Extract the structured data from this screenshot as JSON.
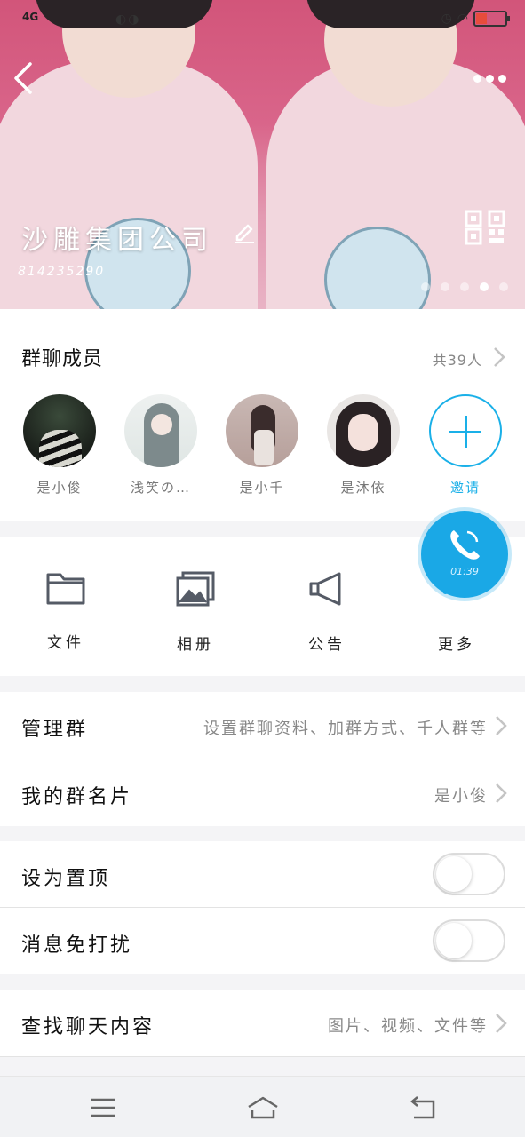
{
  "status_bar": {
    "signal": "4G",
    "time_partial": "09"
  },
  "header": {
    "group_name": "沙雕集团公司",
    "group_id": "814235290",
    "carousel_total": 5,
    "carousel_active": 4
  },
  "members": {
    "title": "群聊成员",
    "count_label": "共39人",
    "list": [
      {
        "name": "是小俊"
      },
      {
        "name": "浅笑の…"
      },
      {
        "name": "是小千"
      },
      {
        "name": "是沐依"
      }
    ],
    "invite_label": "邀请"
  },
  "tools": {
    "files": "文件",
    "album": "相册",
    "notice": "公告",
    "more": "更多"
  },
  "call": {
    "duration": "01:39"
  },
  "settings": {
    "manage": {
      "label": "管理群",
      "value": "设置群聊资料、加群方式、千人群等"
    },
    "my_card": {
      "label": "我的群名片",
      "value": "是小俊"
    },
    "pin_top": {
      "label": "设为置顶",
      "on": false
    },
    "mute": {
      "label": "消息免打扰",
      "on": false
    },
    "search_history": {
      "label": "查找聊天内容",
      "value": "图片、视频、文件等"
    }
  },
  "colors": {
    "accent": "#1ab0e8",
    "header_pink": "#d9658a"
  }
}
